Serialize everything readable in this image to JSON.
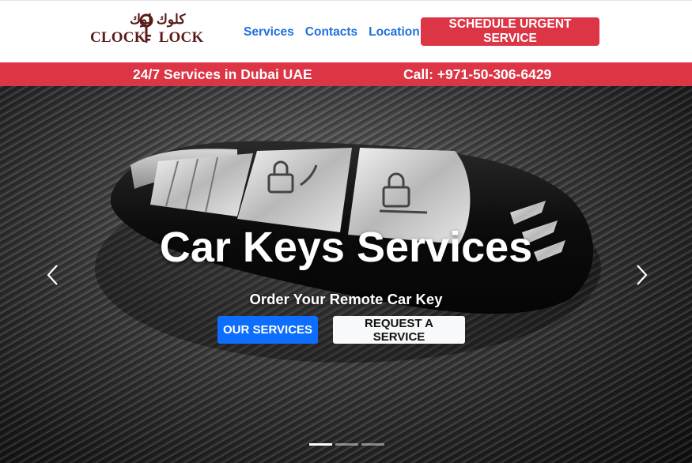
{
  "header": {
    "logo": {
      "arabic_text": "كلوك لوك",
      "brand_word_1": "CLOCK",
      "brand_word_2": "LOCK"
    },
    "nav": [
      {
        "label": "Services"
      },
      {
        "label": "Contacts"
      },
      {
        "label": "Location"
      }
    ],
    "cta_label": "SCHEDULE URGENT SERVICE"
  },
  "infobar": {
    "availability": "24/7 Services in Dubai UAE",
    "phone": "Call: +971-50-306-6429"
  },
  "hero": {
    "title": "Car Keys Services",
    "subtitle": "Order Your Remote Car Key",
    "primary_button": "OUR SERVICES",
    "secondary_button": "REQUEST A SERVICE",
    "slide_count": 3,
    "active_slide": 1
  },
  "colors": {
    "accent_red": "#dc3545",
    "nav_blue": "#1f6fe0",
    "primary_blue": "#0d6efd",
    "brand_maroon": "#5b1a1a"
  },
  "icons": {
    "prev": "chevron-left-icon",
    "next": "chevron-right-icon",
    "logo_key": "key-icon"
  }
}
